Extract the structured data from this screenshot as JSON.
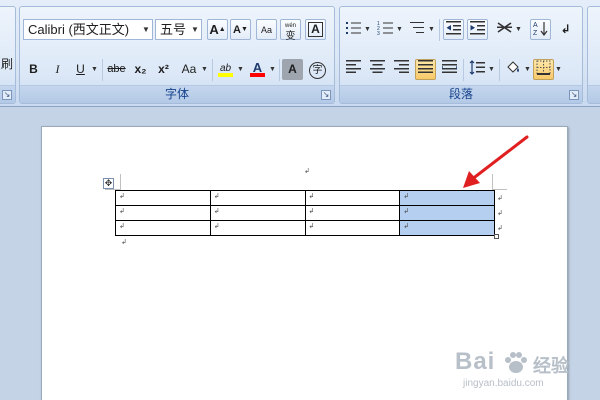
{
  "ribbon": {
    "left_stub_label": "刷",
    "font_group": {
      "title": "字体",
      "font_name": "Calibri (西文正文)",
      "font_size": "五号",
      "grow_font_label": "A",
      "shrink_font_label": "A",
      "bold_label": "B",
      "italic_label": "I",
      "underline_label": "U",
      "strikethrough_label": "abe",
      "subscript_label": "x₂",
      "superscript_label": "x²",
      "change_case_label": "Aa",
      "highlight_label": "ab",
      "font_color_label": "A",
      "char_shading_label": "A",
      "enclose_char_label": "字",
      "phonetic_label": "wén",
      "phonetic_char_label": "变",
      "char_border_label": "A",
      "clear_format_label": "Aa",
      "highlight_color": "#ffff00",
      "font_color": "#ff0000"
    },
    "paragraph_group": {
      "title": "段落"
    }
  },
  "document": {
    "paragraph_mark": "↲",
    "table": {
      "rows": [
        [
          "↲",
          "↲",
          "↲",
          "↲"
        ],
        [
          "↲",
          "↲",
          "↲",
          "↲"
        ],
        [
          "↲",
          "↲",
          "↲",
          "↲"
        ]
      ],
      "row_end_marks": [
        "↲",
        "↲",
        "↲"
      ],
      "selected_column": 3,
      "selection_color": "#b5cff0"
    },
    "move_handle_icon": "move-arrows-icon"
  },
  "annotation": {
    "arrow_color": "#e02020"
  },
  "watermark": {
    "brand": "Bai",
    "brand_cn": "经验",
    "url": "jingyan.baidu.com"
  }
}
